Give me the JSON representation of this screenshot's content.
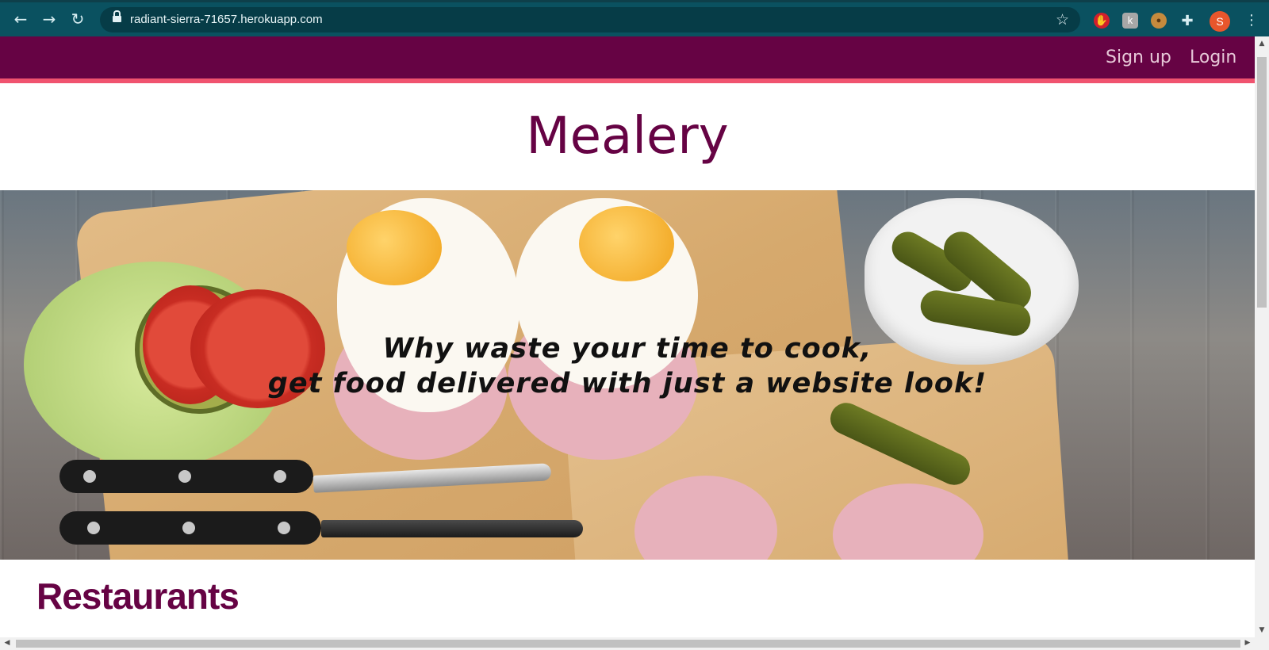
{
  "browser": {
    "url": "radiant-sierra-71657.herokuapp.com",
    "back_icon": "←",
    "forward_icon": "→",
    "reload_icon": "↻",
    "star_icon": "☆",
    "extension_k": "k",
    "profile_initial": "S",
    "menu_icon": "⋮"
  },
  "navbar": {
    "signup_label": "Sign up",
    "login_label": "Login"
  },
  "brand": {
    "title": "Mealery"
  },
  "hero": {
    "line1": "Why waste your time to cook,",
    "line2": "get food delivered with just a website look!"
  },
  "sections": {
    "restaurants_heading": "Restaurants"
  },
  "colors": {
    "brand_purple": "#660344",
    "accent_pink": "#f0536f",
    "chrome_teal": "#0a5160"
  }
}
